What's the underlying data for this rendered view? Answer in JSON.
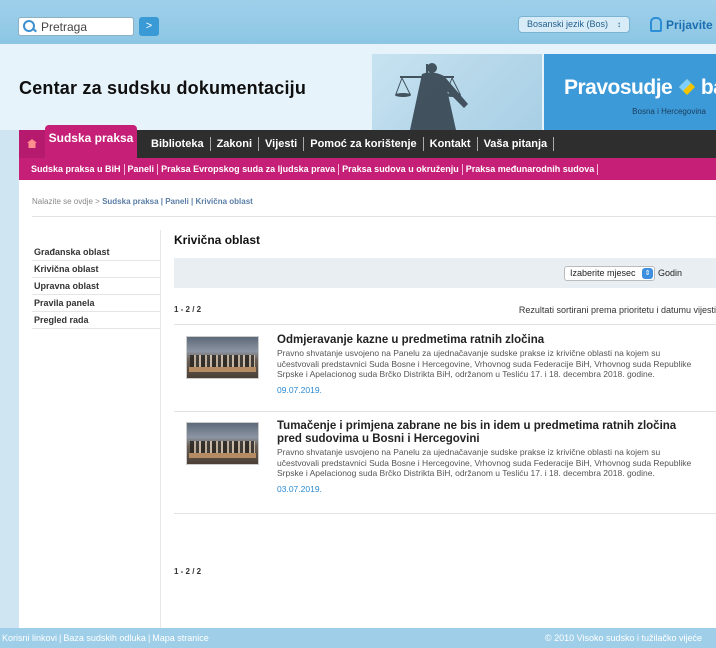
{
  "search": {
    "placeholder": "Pretraga",
    "go": ">"
  },
  "language": {
    "selected": "Bosanski jezik (Bos)",
    "arrow": "↕"
  },
  "login": {
    "label": "Prijavite se"
  },
  "header": {
    "site_title": "Centar za sudsku dokumentaciju",
    "brand_left": "Pravosudje",
    "brand_right": "ba",
    "brand_sub": "Bosna i Hercegovina"
  },
  "nav": {
    "active": "Sudska praksa",
    "items": [
      "Biblioteka",
      "Zakoni",
      "Vijesti",
      "Pomoć za korištenje",
      "Kontakt",
      "Vaša pitanja"
    ]
  },
  "subnav": {
    "items": [
      "Sudska praksa u BiH",
      "Paneli",
      "Praksa Evropskog suda za ljudska prava",
      "Praksa sudova u okruženju",
      "Praksa međunarodnih sudova"
    ]
  },
  "breadcrumb": {
    "prefix": "Nalazite se ovdje >",
    "path": "Sudska praksa | Paneli | Krivična oblast"
  },
  "sidebar": {
    "items": [
      "Građanska oblast",
      "Krivična oblast",
      "Upravna oblast",
      "Pravila panela",
      "Pregled rada"
    ]
  },
  "main": {
    "title": "Krivična oblast",
    "month_select": "Izaberite mjesec",
    "year_label": "Godin",
    "pager": "1 - 2 / 2",
    "sort_note": "Rezultati sortirani prema prioritetu i datumu vijesti"
  },
  "articles": [
    {
      "title": "Odmjeravanje kazne u predmetima ratnih zločina",
      "text": "Pravno shvatanje usvojeno na Panelu za ujednačavanje sudske prakse iz krivične oblasti na kojem su učestvovali predstavnici Suda Bosne i Hercegovine, Vrhovnog suda Federacije BiH, Vrhovnog suda Republike Srpske i Apelacionog suda Brčko Distrikta BiH, održanom u Tesliću 17. i 18. decembra 2018. godine.",
      "date": "09.07.2019."
    },
    {
      "title": "Tumačenje i primjena zabrane ne bis in idem u predmetima ratnih zločina pred sudovima u Bosni i Hercegovini",
      "text": "Pravno shvatanje usvojeno na Panelu za ujednačavanje sudske prakse iz krivične oblasti na kojem su učestvovali predstavnici Suda Bosne i Hercegovine, Vrhovnog suda Federacije BiH, Vrhovnog suda Republike Srpske i Apelacionog suda Brčko Distrikta BiH, održanom u Tesliću 17. i 18. decembra 2018. godine.",
      "date": "03.07.2019."
    }
  ],
  "footer": {
    "links": [
      "Korisni linkovi",
      "Baza sudskih odluka",
      "Mapa stranice"
    ],
    "copyright": "© 2010 Visoko sudsko i tužilačko vijeće"
  },
  "colors": {
    "accent": "#c51f78",
    "nav_bg": "#2e2e2e",
    "brand_blue": "#3d9ad8",
    "link_blue": "#2a8ad2"
  }
}
